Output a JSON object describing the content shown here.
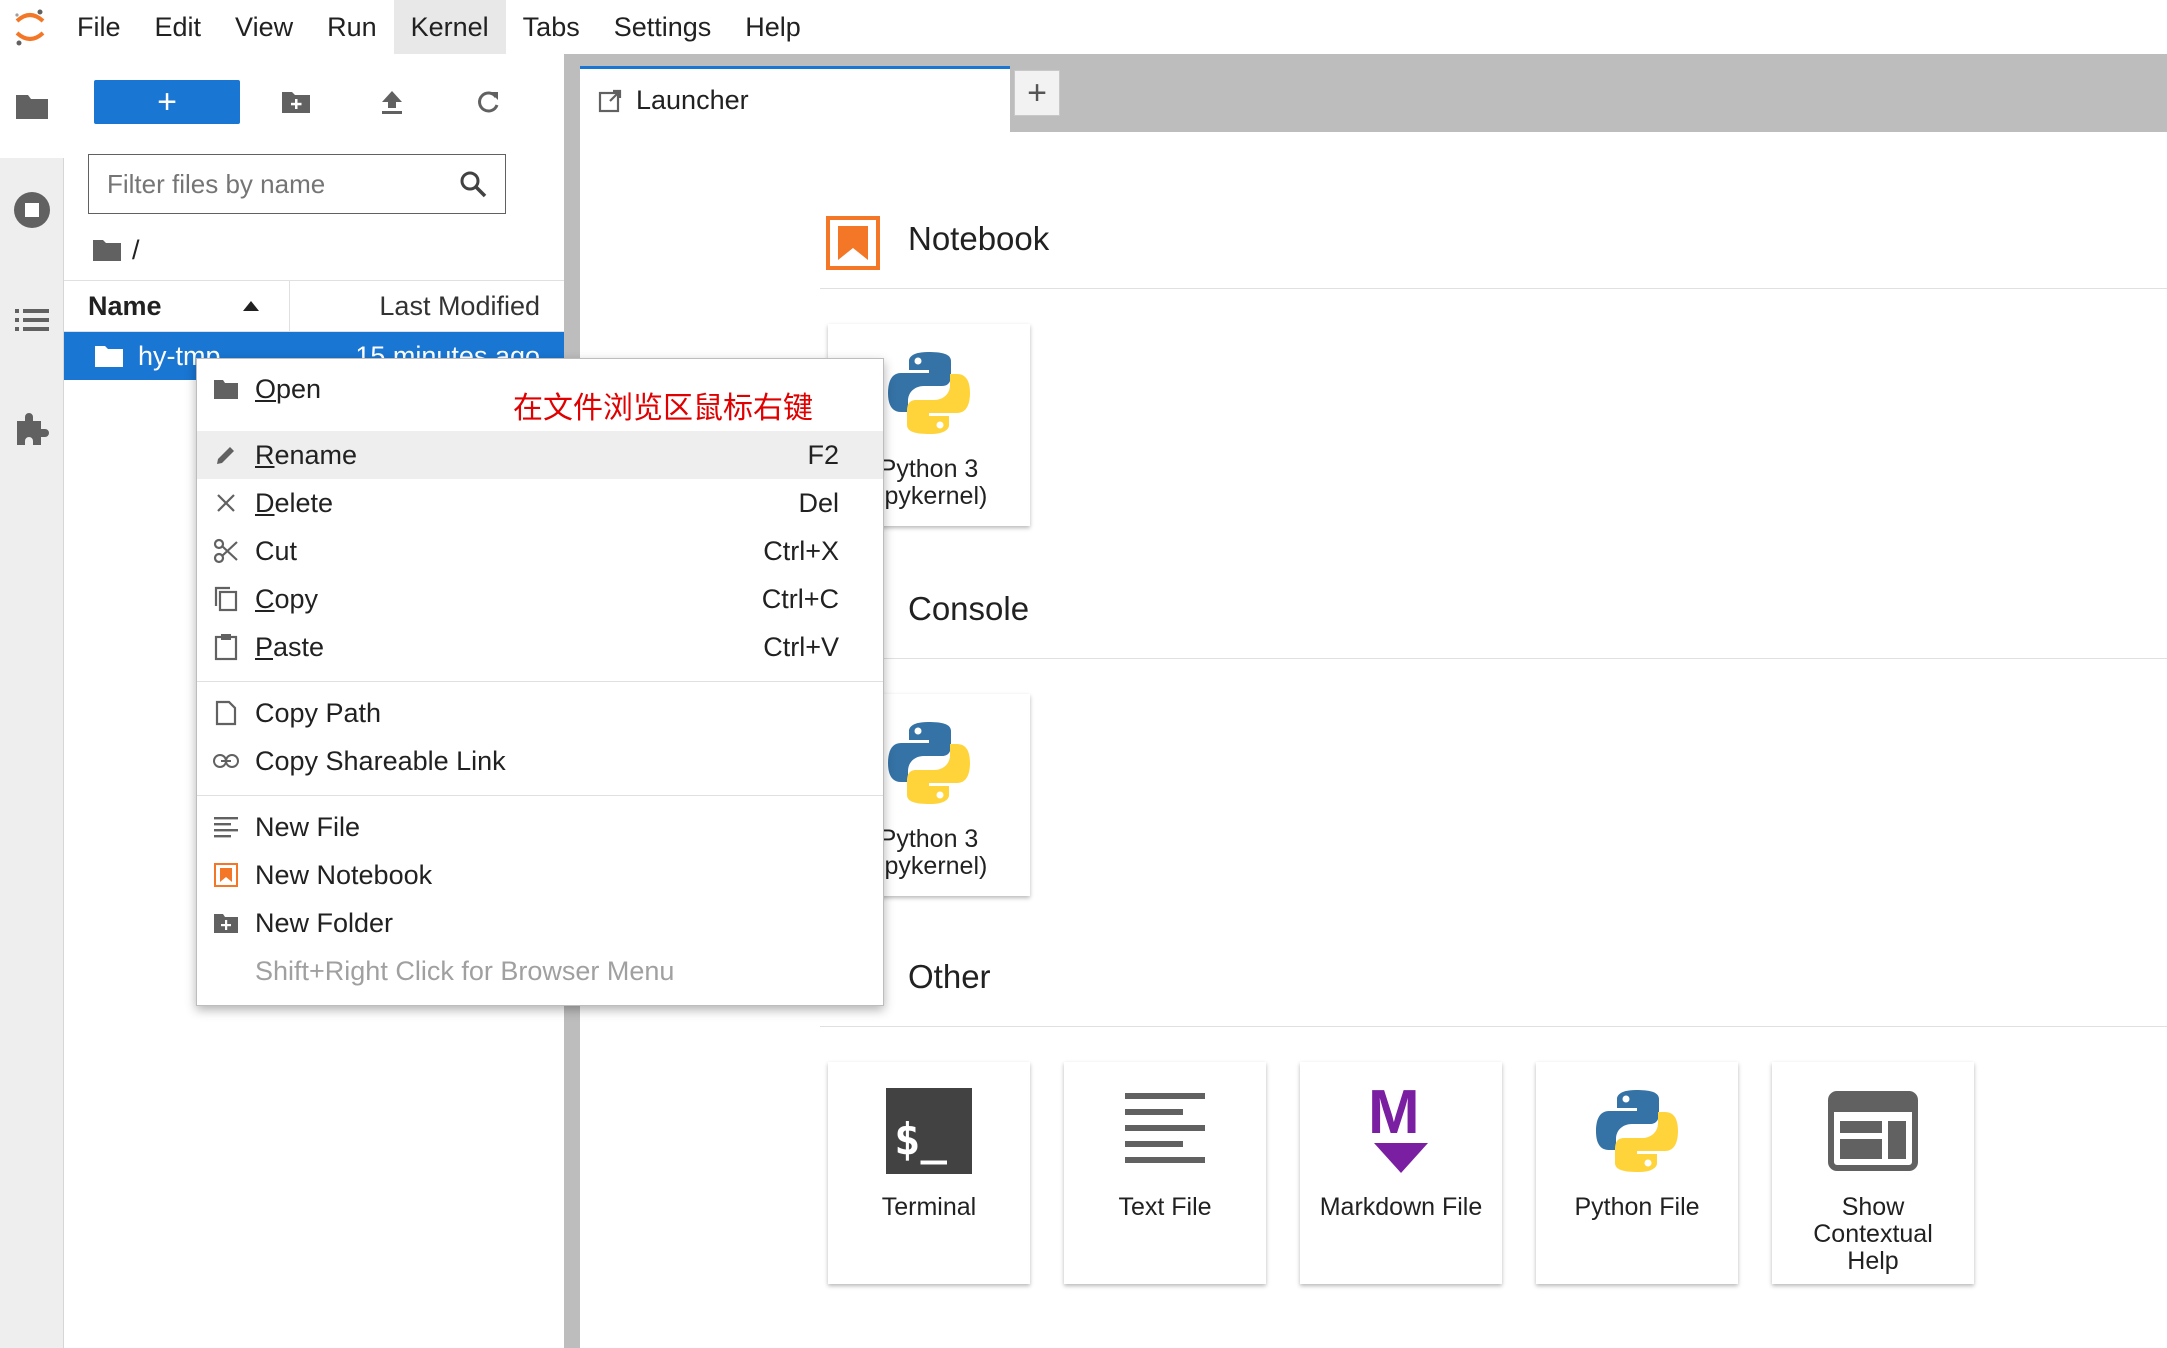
{
  "menubar": {
    "items": [
      "File",
      "Edit",
      "View",
      "Run",
      "Kernel",
      "Tabs",
      "Settings",
      "Help"
    ],
    "active": "Kernel"
  },
  "filebrowser": {
    "new_button_label": "+",
    "filter_placeholder": "Filter files by name",
    "breadcrumb": "/",
    "columns": {
      "name": "Name",
      "modified": "Last Modified"
    },
    "rows": [
      {
        "name": "hy-tmp",
        "modified": "15 minutes ago",
        "selected": true
      }
    ]
  },
  "tabs": {
    "items": [
      {
        "label": "Launcher",
        "active": true
      }
    ],
    "add_label": "+"
  },
  "launcher": {
    "sections": [
      {
        "title": "Notebook",
        "cards": [
          {
            "label_line1": "Python 3",
            "label_line2": "(ipykernel)",
            "icon": "python-icon"
          }
        ]
      },
      {
        "title": "Console",
        "cards": [
          {
            "label_line1": "Python 3",
            "label_line2": "(ipykernel)",
            "icon": "python-icon"
          }
        ]
      },
      {
        "title": "Other",
        "cards": [
          {
            "label": "Terminal",
            "icon": "terminal-icon"
          },
          {
            "label": "Text File",
            "icon": "text-file-icon"
          },
          {
            "label": "Markdown File",
            "icon": "markdown-icon"
          },
          {
            "label": "Python File",
            "icon": "python-icon"
          },
          {
            "label_line1": "Show",
            "label_line2": "Contextual",
            "label_line3": "Help",
            "icon": "contextual-help-icon"
          }
        ]
      }
    ]
  },
  "context_menu": {
    "annotation": "在文件浏览区鼠标右键",
    "items": [
      {
        "first": "O",
        "rest": "pen",
        "key": ""
      },
      {
        "first": "R",
        "rest": "ename",
        "key": "F2"
      },
      {
        "first": "D",
        "rest": "elete",
        "key": "Del"
      },
      {
        "first": "",
        "rest": "Cut",
        "key": "Ctrl+X"
      },
      {
        "first": "C",
        "rest": "opy",
        "key": "Ctrl+C"
      },
      {
        "first": "P",
        "rest": "aste",
        "key": "Ctrl+V"
      },
      {
        "first": "",
        "rest": "Copy Path",
        "key": ""
      },
      {
        "first": "",
        "rest": "Copy Shareable Link",
        "key": ""
      },
      {
        "first": "",
        "rest": "New File",
        "key": ""
      },
      {
        "first": "",
        "rest": "New Notebook",
        "key": ""
      },
      {
        "first": "",
        "rest": "New Folder",
        "key": ""
      },
      {
        "first": "",
        "rest": "Shift+Right Click for Browser Menu",
        "key": ""
      }
    ]
  },
  "colors": {
    "accent": "#1976d2",
    "jupyter_orange": "#f37726",
    "annotation_red": "#e00000",
    "python_blue": "#3572a5",
    "python_yellow": "#ffd43b",
    "markdown_purple": "#7b1fa2"
  }
}
